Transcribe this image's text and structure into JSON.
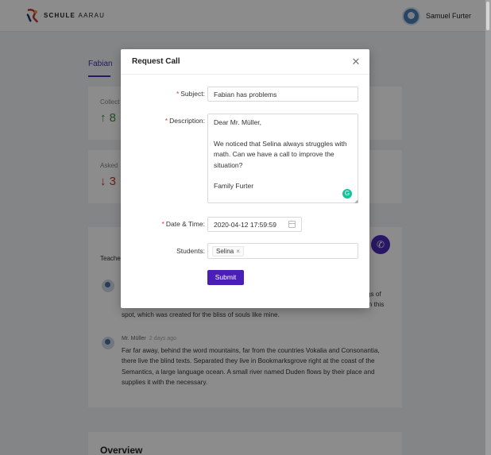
{
  "header": {
    "logo_text_bold": "SCHULE",
    "logo_text_light": "AARAU",
    "user_name": "Samuel Furter"
  },
  "background": {
    "tab_active": "Fabian",
    "card1_label": "Collect",
    "card1_value": "8",
    "card2_label": "Asked",
    "card2_value": "3",
    "teachers_label": "Teache",
    "comment1_fragment_right1": "gs of",
    "comment1_fragment_right2": "in this",
    "comment1_tail": "spot, which was created for the bliss of souls like mine.",
    "comment2_author": "Mr. Müller",
    "comment2_ago": "2 days ago",
    "comment2_text": "Far far away, behind the word mountains, far from the countries Vokalia and Consonantia, there live the blind texts. Separated they live in Bookmarksgrove right at the coast of the Semantics, a large language ocean. A small river named Duden flows by their place and supplies it with the necessary.",
    "overview_title": "Overview"
  },
  "modal": {
    "title": "Request Call",
    "fields": {
      "subject_label": "Subject",
      "subject_value": "Fabian has problems",
      "description_label": "Description",
      "description_value": "Dear Mr. Müller,\n\nWe noticed that Selina always struggles with math. Can we have a call to improve the situation?\n\nFamily Furter",
      "datetime_label": "Date & Time",
      "datetime_value": "2020-04-12 17:59:59",
      "students_label": "Students",
      "students_tags": [
        "Selina"
      ]
    },
    "submit_label": "Submit"
  },
  "colors": {
    "primary": "#4a1fb8",
    "required": "#e03a3a",
    "success": "#3f8a3f",
    "danger": "#c0392b"
  },
  "icons": {
    "close": "close-icon",
    "calendar": "calendar-icon",
    "phone": "phone-icon",
    "arrow_up": "arrow-up-icon",
    "arrow_down": "arrow-down-icon"
  }
}
